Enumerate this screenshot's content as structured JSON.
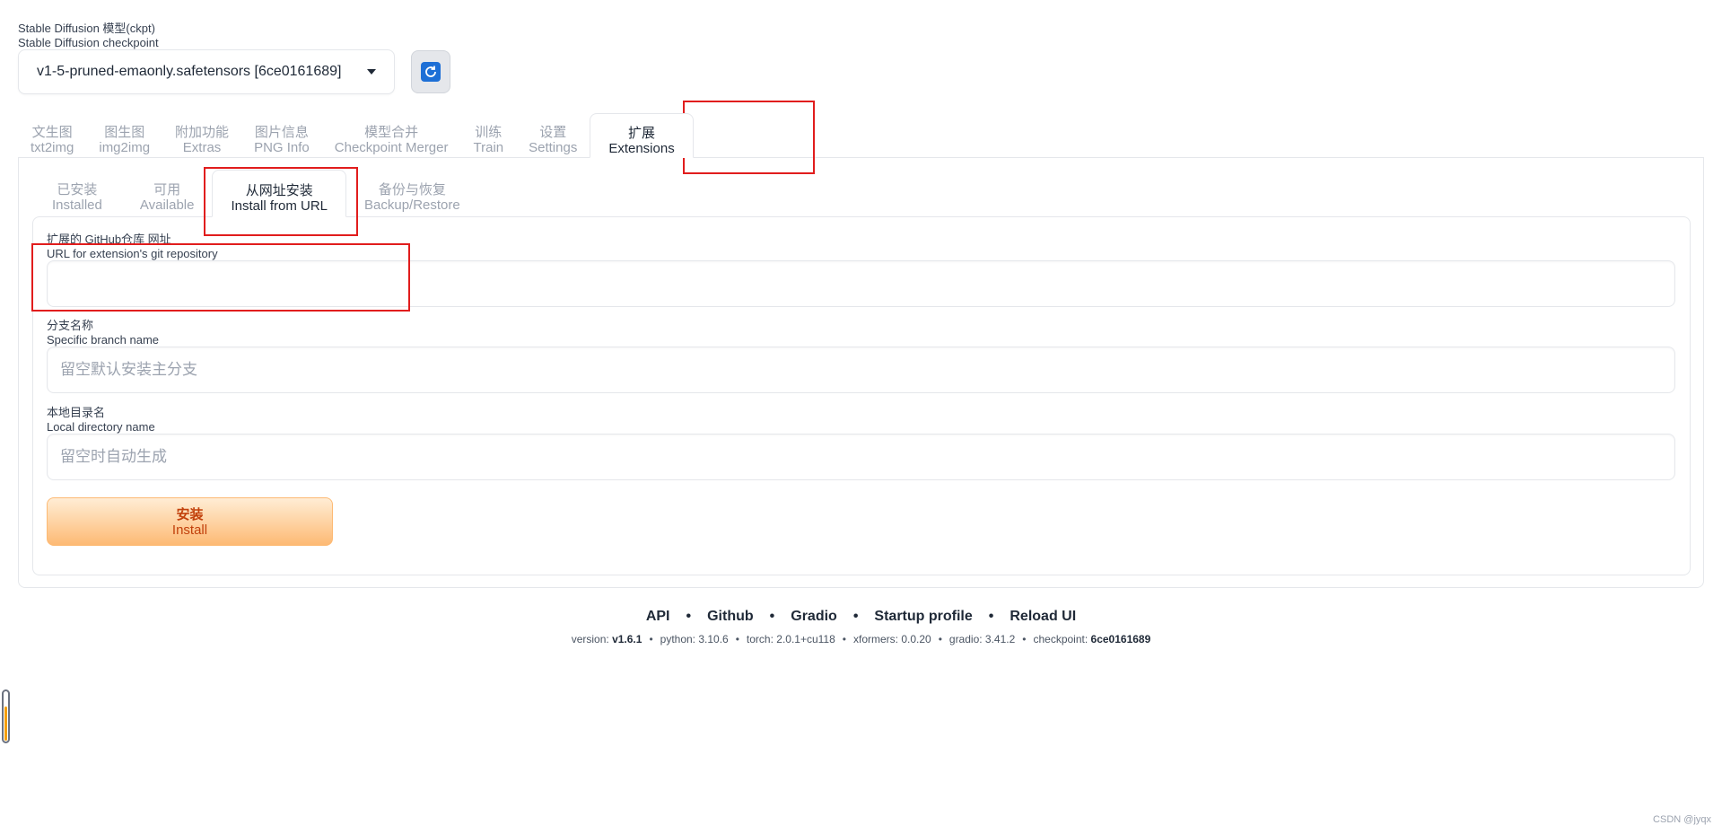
{
  "checkpoint": {
    "label_zh": "Stable Diffusion 模型(ckpt)",
    "label_en": "Stable Diffusion checkpoint",
    "selected": "v1-5-pruned-emaonly.safetensors [6ce0161689]"
  },
  "main_tabs": [
    {
      "zh": "文生图",
      "en": "txt2img"
    },
    {
      "zh": "图生图",
      "en": "img2img"
    },
    {
      "zh": "附加功能",
      "en": "Extras"
    },
    {
      "zh": "图片信息",
      "en": "PNG Info"
    },
    {
      "zh": "模型合并",
      "en": "Checkpoint Merger"
    },
    {
      "zh": "训练",
      "en": "Train"
    },
    {
      "zh": "设置",
      "en": "Settings"
    },
    {
      "zh": "扩展",
      "en": "Extensions"
    }
  ],
  "sub_tabs": [
    {
      "zh": "已安装",
      "en": "Installed"
    },
    {
      "zh": "可用",
      "en": "Available"
    },
    {
      "zh": "从网址安装",
      "en": "Install from URL"
    },
    {
      "zh": "备份与恢复",
      "en": "Backup/Restore"
    }
  ],
  "fields": {
    "url": {
      "label_zh": "扩展的 GitHub仓库 网址",
      "label_en": "URL for extension's git repository",
      "value": ""
    },
    "branch": {
      "label_zh": "分支名称",
      "label_en": "Specific branch name",
      "placeholder": "留空默认安装主分支"
    },
    "dir": {
      "label_zh": "本地目录名",
      "label_en": "Local directory name",
      "placeholder": "留空时自动生成"
    }
  },
  "install_button": {
    "zh": "安装",
    "en": "Install"
  },
  "footer": {
    "links": [
      "API",
      "Github",
      "Gradio",
      "Startup profile",
      "Reload UI"
    ],
    "version_label": "version:",
    "version": "v1.6.1",
    "python": "python: 3.10.6",
    "torch": "torch: 2.0.1+cu118",
    "xformers": "xformers: 0.0.20",
    "gradio": "gradio: 3.41.2",
    "checkpoint_label": "checkpoint:",
    "checkpoint": "6ce0161689"
  },
  "watermark": "CSDN @jyqx",
  "colors": {
    "annotation": "#e11d1d",
    "accent": "#f97316",
    "install_text": "#c2410c"
  }
}
